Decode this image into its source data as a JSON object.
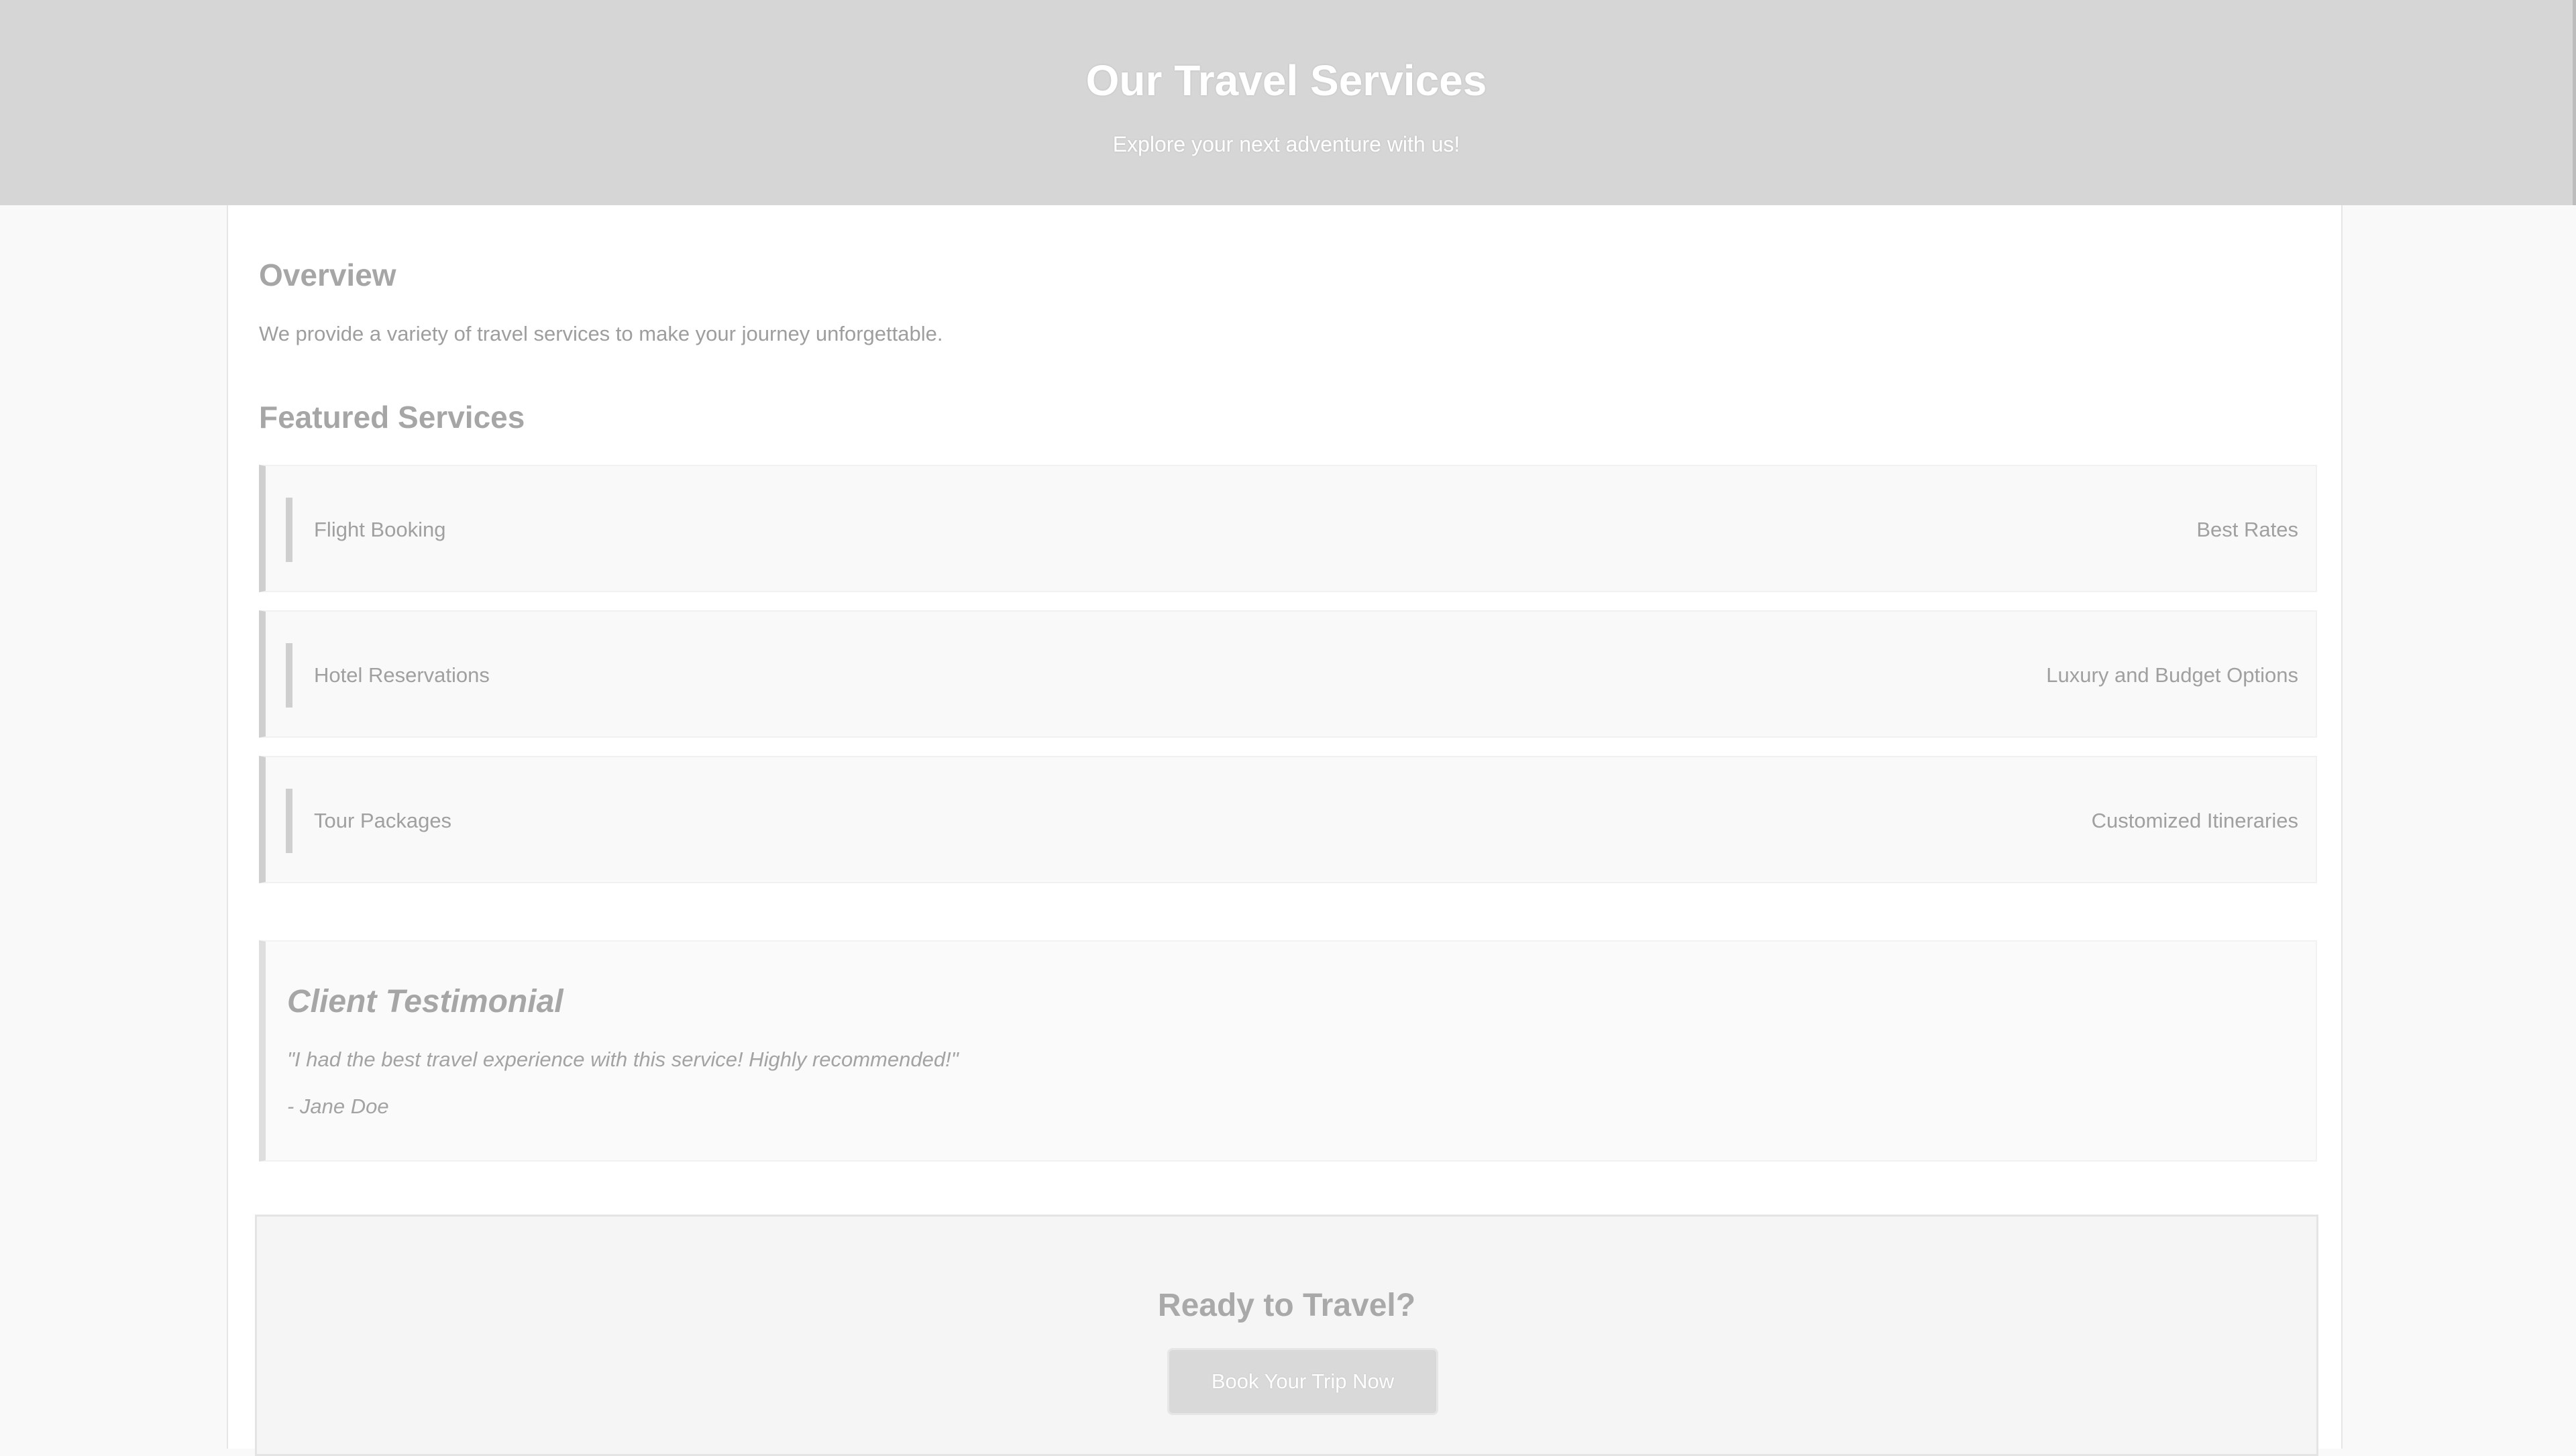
{
  "header": {
    "title": "Our Travel Services",
    "subtitle": "Explore your next adventure with us!"
  },
  "overview": {
    "heading": "Overview",
    "text": "We provide a variety of travel services to make your journey unforgettable."
  },
  "featured": {
    "heading": "Featured Services",
    "services": [
      {
        "name": "Flight Booking",
        "tag": "Best Rates"
      },
      {
        "name": "Hotel Reservations",
        "tag": "Luxury and Budget Options"
      },
      {
        "name": "Tour Packages",
        "tag": "Customized Itineraries"
      }
    ]
  },
  "testimonial": {
    "heading": "Client Testimonial",
    "quote": "\"I had the best travel experience with this service! Highly recommended!\"",
    "author": "- Jane Doe"
  },
  "cta": {
    "heading": "Ready to Travel?",
    "button_label": "Book Your Trip Now"
  },
  "colors": {
    "header_bg": "#d6d6d6",
    "page_bg": "#f9f9f9",
    "card_accent": "#cfcfcf",
    "button_bg": "#d9d9d9"
  }
}
